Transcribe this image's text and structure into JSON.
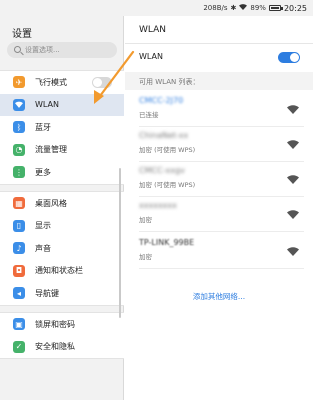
{
  "status_bar": {
    "speed": "208B/s",
    "battery_pct": "89%",
    "time": "20:25"
  },
  "left_pane": {
    "title": "设置",
    "search_placeholder": "设置选项...",
    "groups": [
      [
        {
          "label": "飞行模式",
          "icon": "airplane-icon",
          "color": "#f29a2e",
          "toggle": "off"
        },
        {
          "label": "WLAN",
          "icon": "wifi-icon",
          "color": "#3b8ee8",
          "selected": true
        },
        {
          "label": "蓝牙",
          "icon": "bluetooth-icon",
          "color": "#3b8ee8"
        },
        {
          "label": "流量管理",
          "icon": "data-usage-icon",
          "color": "#45b26a"
        },
        {
          "label": "更多",
          "icon": "more-icon",
          "color": "#45b26a"
        }
      ],
      [
        {
          "label": "桌面风格",
          "icon": "home-style-icon",
          "color": "#f06b3c"
        },
        {
          "label": "显示",
          "icon": "display-icon",
          "color": "#3b8ee8"
        },
        {
          "label": "声音",
          "icon": "sound-icon",
          "color": "#3b8ee8"
        },
        {
          "label": "通知和状态栏",
          "icon": "notification-icon",
          "color": "#f06b3c"
        },
        {
          "label": "导航键",
          "icon": "navigation-key-icon",
          "color": "#3b8ee8"
        }
      ],
      [
        {
          "label": "锁屏和密码",
          "icon": "lock-icon",
          "color": "#3b8ee8"
        },
        {
          "label": "安全和隐私",
          "icon": "security-icon",
          "color": "#45b26a"
        }
      ]
    ]
  },
  "right_pane": {
    "title": "WLAN",
    "wlan_toggle_label": "WLAN",
    "wlan_toggle_state": "on",
    "section_label": "可用 WLAN 列表：",
    "networks": [
      {
        "name": "CMCC-2J70",
        "status": "已连接",
        "name_style": "connected"
      },
      {
        "name": "ChinaNet-xx",
        "status": "加密 (可使用 WPS)",
        "name_style": "blurred"
      },
      {
        "name": "CMCC-xxgv",
        "status": "加密 (可使用 WPS)",
        "name_style": "blurred"
      },
      {
        "name": "xxxxxxxx",
        "status": "加密",
        "name_style": "blurred"
      },
      {
        "name": "TP-LINK_99BE",
        "status": "加密",
        "name_style": "blurred"
      }
    ],
    "add_network_label": "添加其他网络..."
  },
  "colors": {
    "accent": "#2d7de0",
    "selected_bg": "#dfe6f1",
    "annotation_arrow": "#f29a2e"
  }
}
